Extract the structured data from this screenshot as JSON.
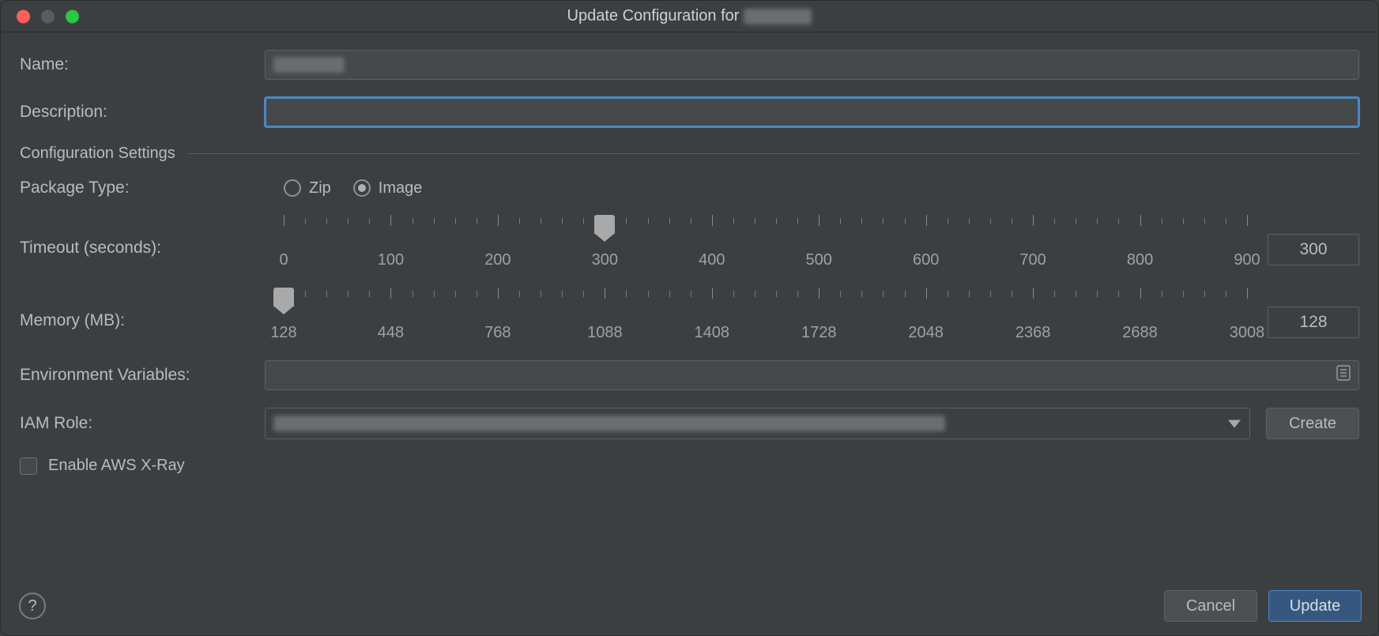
{
  "title_prefix": "Update Configuration for",
  "labels": {
    "name": "Name:",
    "description": "Description:",
    "section": "Configuration Settings",
    "package_type": "Package Type:",
    "zip": "Zip",
    "image": "Image",
    "timeout": "Timeout (seconds):",
    "memory": "Memory (MB):",
    "env": "Environment Variables:",
    "iam": "IAM Role:",
    "create": "Create",
    "xray": "Enable AWS X-Ray",
    "cancel": "Cancel",
    "update": "Update",
    "help": "?"
  },
  "fields": {
    "name_value": "",
    "description_value": "",
    "package_type": "Image",
    "timeout": {
      "min": 0,
      "max": 900,
      "major_step": 100,
      "minor_per_major": 5,
      "value": 300
    },
    "memory": {
      "min": 128,
      "max": 3008,
      "major_step": 320,
      "minor_per_major": 5,
      "value": 128
    },
    "env_value": "",
    "iam_value": "",
    "xray_enabled": false
  },
  "tick_labels_timeout": [
    "0",
    "100",
    "200",
    "300",
    "400",
    "500",
    "600",
    "700",
    "800",
    "900"
  ],
  "tick_labels_memory": [
    "128",
    "448",
    "768",
    "1088",
    "1408",
    "1728",
    "2048",
    "2368",
    "2688",
    "3008"
  ]
}
